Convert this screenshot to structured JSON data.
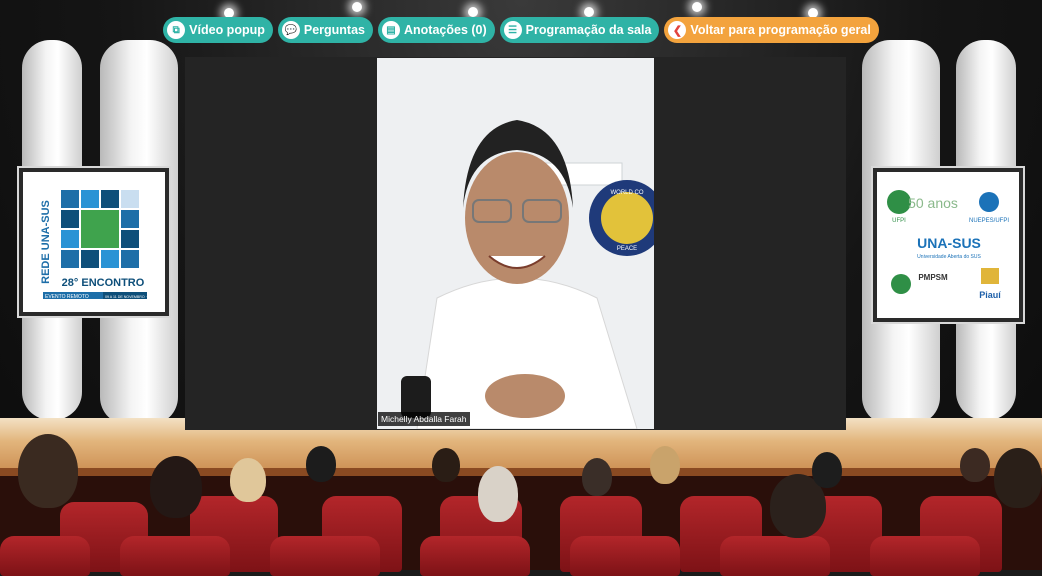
{
  "toolbar": {
    "buttons": [
      {
        "label": "Vídeo popup",
        "icon": "external-link-icon"
      },
      {
        "label": "Perguntas",
        "icon": "chat-bubbles-icon"
      },
      {
        "label": "Anotações (0)",
        "icon": "note-icon"
      },
      {
        "label": "Programação da sala",
        "icon": "list-icon"
      },
      {
        "label": "Voltar para programação geral",
        "icon": "back-icon"
      }
    ]
  },
  "video": {
    "participant_name": "Michelly Abdalla Farah",
    "emblem_text_top": "WORLD CO",
    "emblem_text_bottom": "PEACE"
  },
  "poster_left": {
    "vertical_text": "REDE UNA-SUS",
    "title": "28° ENCONTRO",
    "subtitle": "EVENTO REMOTO",
    "subtitle_right": "09 A 11 DE NOVEMBRO · 2021"
  },
  "poster_right": {
    "logos": [
      "UFPI",
      "50 anos",
      "NUEPES/UFPI",
      "UNA-SUS",
      "Universidade Aberta do SUS",
      "PMPSM",
      "Piauí"
    ]
  },
  "colors": {
    "toolbar_teal": "#2fb3a6",
    "toolbar_orange": "#f3a33d"
  }
}
